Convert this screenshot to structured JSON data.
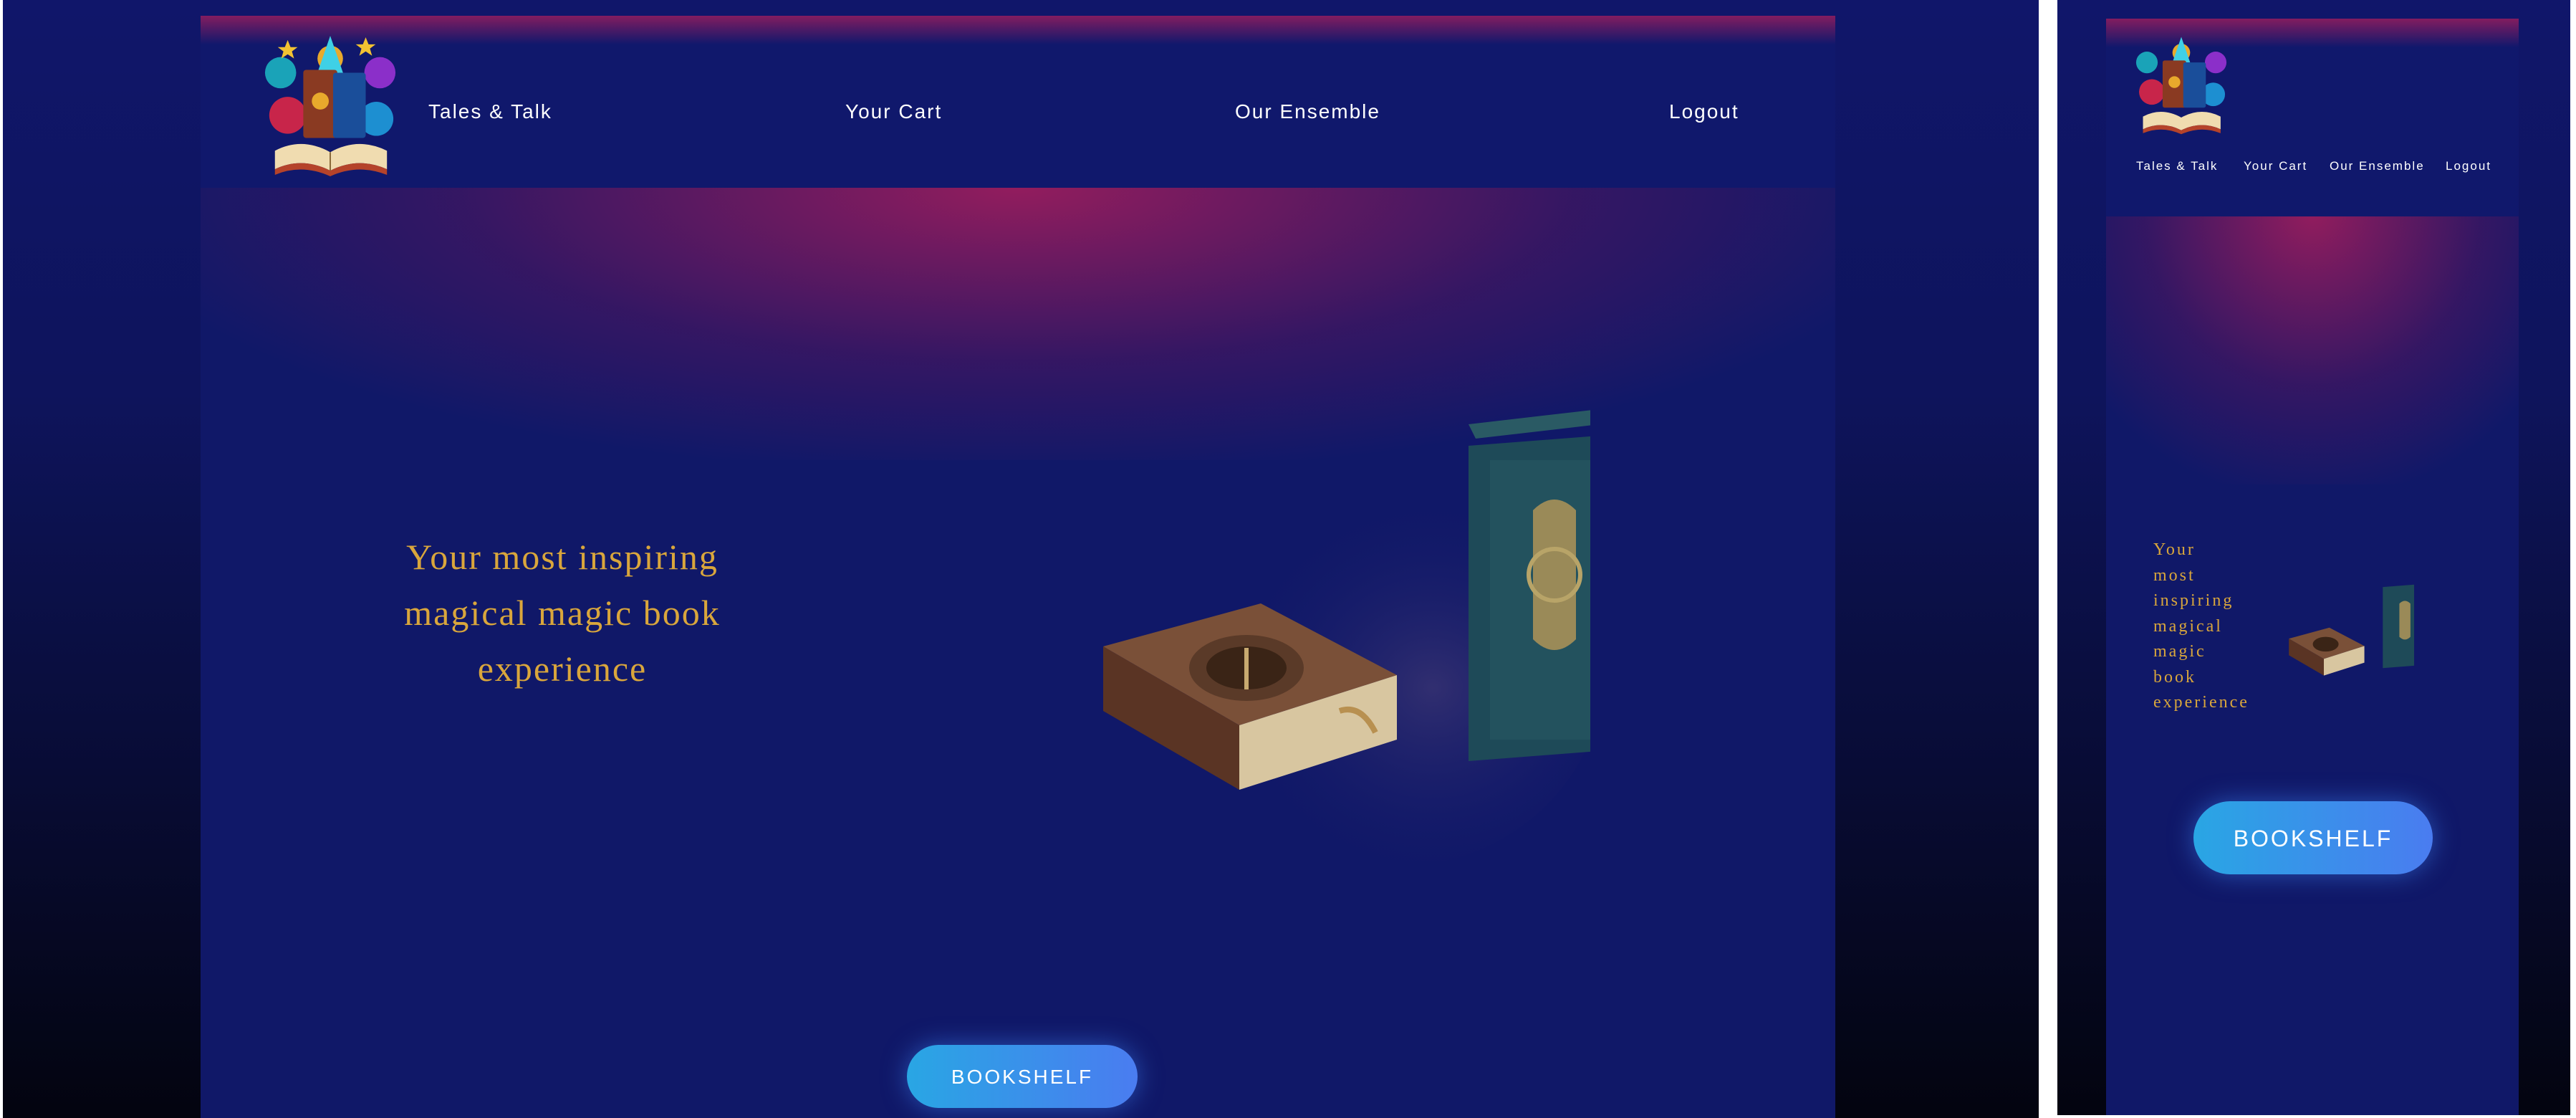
{
  "nav": {
    "brand": "Tales & Talk",
    "cart": "Your Cart",
    "ensemble": "Our Ensemble",
    "logout": "Logout"
  },
  "hero": {
    "headline_lines": [
      "Your most inspiring",
      "magical magic book",
      "experience"
    ],
    "mobile_lines": [
      "Your",
      "most",
      "inspiring",
      "magical",
      "magic",
      "book",
      "experience"
    ],
    "button": "BOOKSHELF"
  },
  "colors": {
    "navbar": "#10186c",
    "page": "#101868",
    "headline": "#d9a63c",
    "button_start": "#29a6e4",
    "button_end": "#4a7cf0"
  },
  "icons": {
    "logo": "magic-book-logo",
    "hero": "magic-books-illustration"
  }
}
